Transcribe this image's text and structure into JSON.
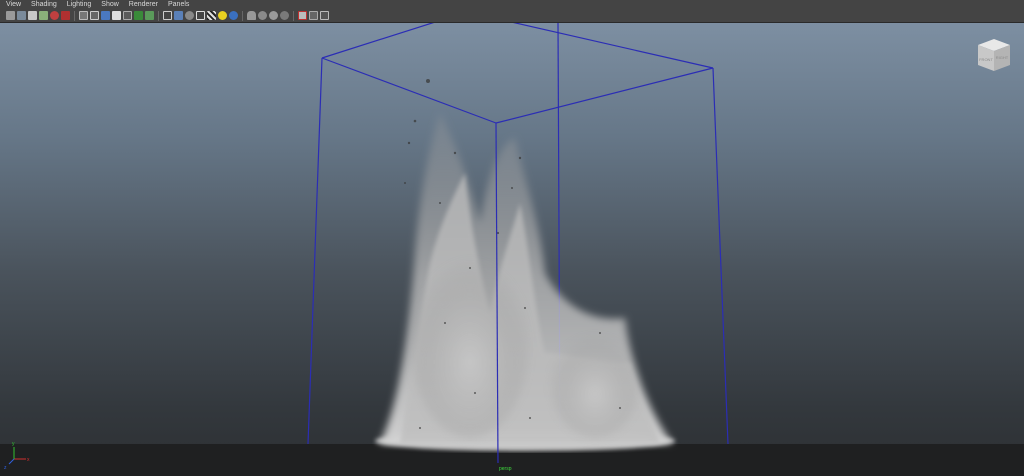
{
  "menu": {
    "view": "View",
    "shading": "Shading",
    "lighting": "Lighting",
    "show": "Show",
    "renderer": "Renderer",
    "panels": "Panels"
  },
  "toolbar": {
    "icons": [
      "select-camera-icon",
      "camera-attributes-icon",
      "bookmark-icon",
      "image-plane-icon",
      "2d-pan-zoom-icon",
      "grease-pencil-icon",
      "grid-icon",
      "film-gate-icon",
      "resolution-gate-icon",
      "gate-mask-icon",
      "field-chart-icon",
      "safe-action-icon",
      "safe-title-icon",
      "wireframe-icon",
      "smooth-shade-icon",
      "flat-shade-icon",
      "bounding-box-icon",
      "textured-icon",
      "lights-icon",
      "shadows-icon",
      "isolate-icon",
      "xray-icon",
      "xray-joints-icon",
      "xray-active-icon",
      "backface-icon",
      "resolution-icon",
      "motion-blur-icon",
      "depth-of-field-icon"
    ]
  },
  "viewcube": {
    "front": "FRONT",
    "right": "RIGHT"
  },
  "viewport": {
    "camera": "persp"
  },
  "axes": {
    "x": "x",
    "y": "y",
    "z": "z"
  },
  "colors": {
    "container": "#2b2db5",
    "fluid": "#c8c8c8",
    "ground": "#1f2021"
  }
}
